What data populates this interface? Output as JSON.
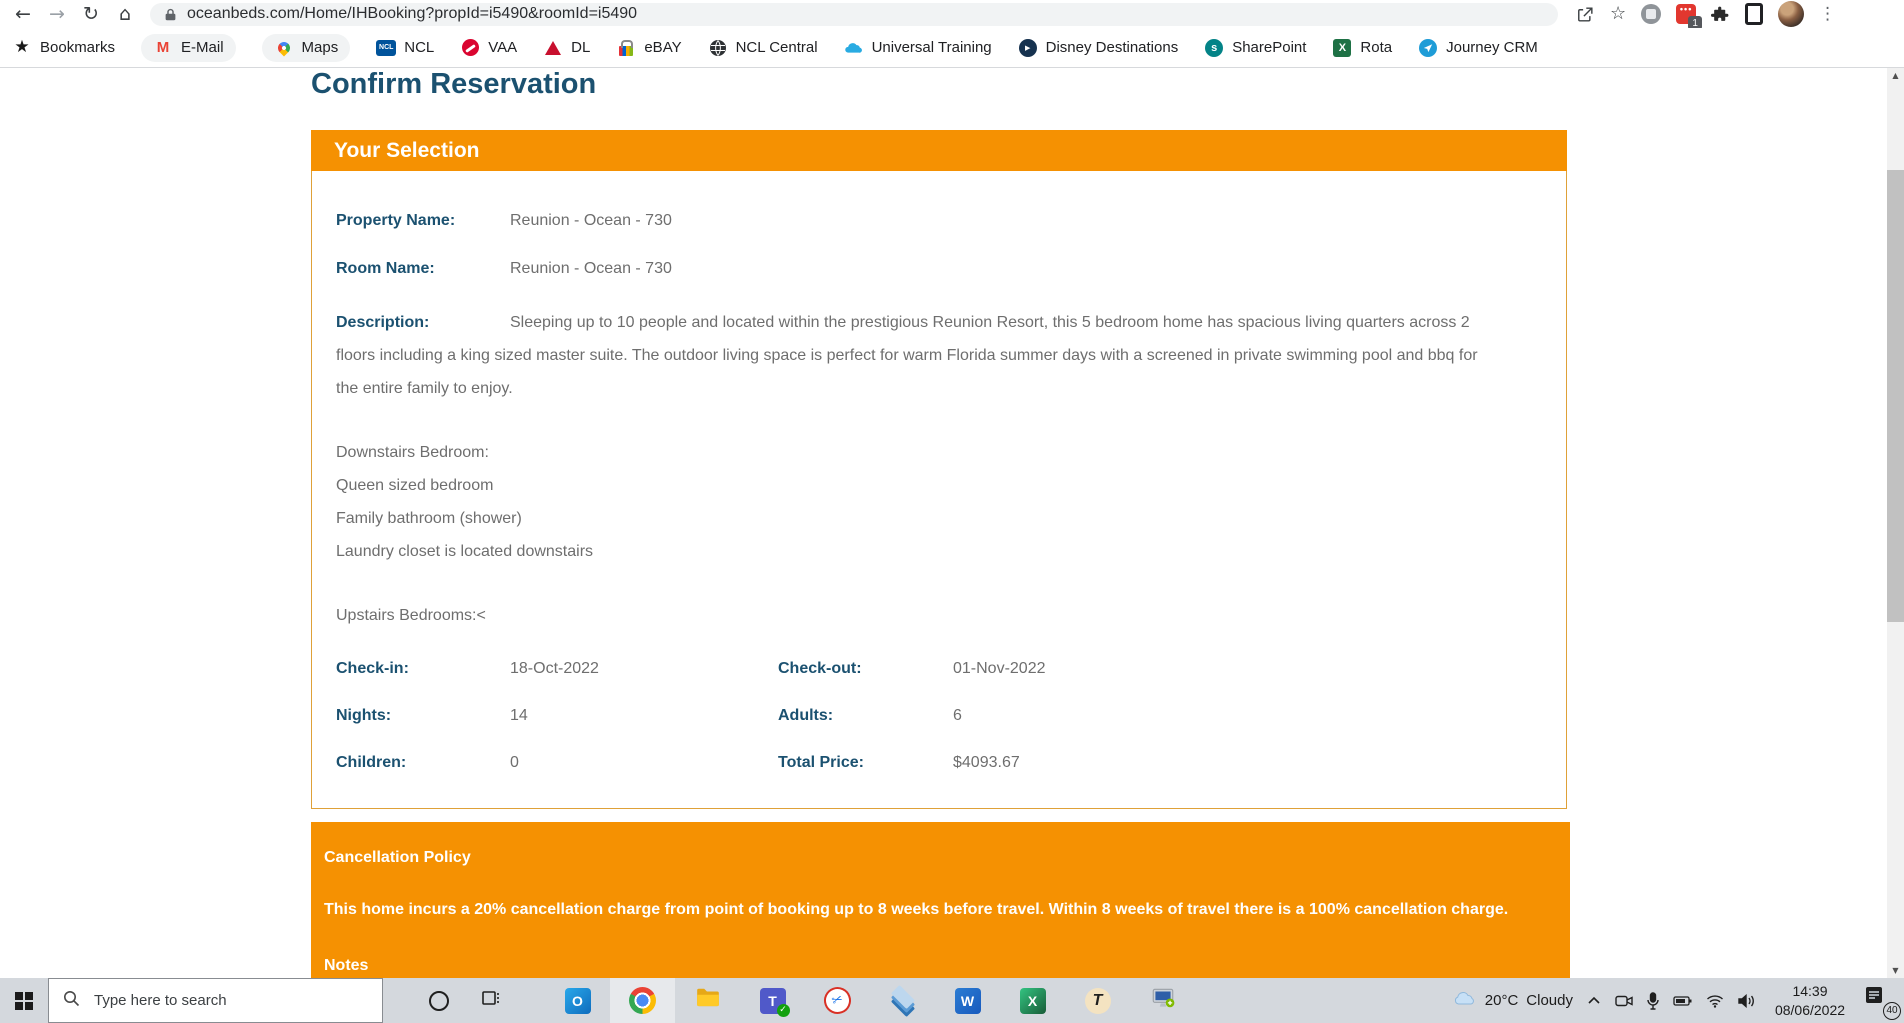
{
  "browser": {
    "url": "oceanbeds.com/Home/IHBooking?propId=i5490&roomId=i5490",
    "extension_badge": "1",
    "bookmarks": [
      {
        "label": "Bookmarks"
      },
      {
        "label": "E-Mail"
      },
      {
        "label": "Maps"
      },
      {
        "label": "NCL"
      },
      {
        "label": "VAA"
      },
      {
        "label": "DL"
      },
      {
        "label": "eBAY"
      },
      {
        "label": "NCL Central"
      },
      {
        "label": "Universal Training"
      },
      {
        "label": "Disney Destinations"
      },
      {
        "label": "SharePoint"
      },
      {
        "label": "Rota"
      },
      {
        "label": "Journey CRM"
      }
    ]
  },
  "page": {
    "heading": "Confirm Reservation",
    "selection": {
      "title": "Your Selection",
      "property_name": {
        "label": "Property Name:",
        "value": "Reunion - Ocean - 730"
      },
      "room_name": {
        "label": "Room Name:",
        "value": "Reunion - Ocean - 730"
      },
      "description": {
        "label": "Description:",
        "text": "Sleeping up to 10 people and located within the prestigious Reunion Resort, this 5 bedroom home has spacious living quarters across 2 floors including a king sized master suite. The outdoor living space is perfect for warm Florida summer days with a screened in private swimming pool and bbq for the entire family to enjoy."
      },
      "detail_lines": [
        "Downstairs Bedroom:",
        "Queen sized bedroom",
        "Family bathroom (shower)",
        "Laundry closet is located downstairs",
        "Upstairs Bedrooms:<"
      ],
      "grid": {
        "check_in": {
          "label": "Check-in:",
          "value": "18-Oct-2022"
        },
        "check_out": {
          "label": "Check-out:",
          "value": "01-Nov-2022"
        },
        "nights": {
          "label": "Nights:",
          "value": "14"
        },
        "adults": {
          "label": "Adults:",
          "value": "6"
        },
        "children": {
          "label": "Children:",
          "value": "0"
        },
        "total_price": {
          "label": "Total Price:",
          "value": "$4093.67"
        }
      }
    },
    "cancellation": {
      "title": "Cancellation Policy",
      "body": "This home incurs a 20% cancellation charge from point of booking up to 8 weeks before travel. Within 8 weeks of travel there is a 100% cancellation charge.",
      "notes_title": "Notes"
    }
  },
  "taskbar": {
    "search_placeholder": "Type here to search",
    "weather": {
      "temp": "20°C",
      "condition": "Cloudy"
    },
    "clock": {
      "time": "14:39",
      "date": "08/06/2022"
    },
    "notification_badge": "40"
  },
  "colors": {
    "accent_orange": "#F59102",
    "heading_navy": "#1B5170",
    "body_gray": "#6E6E6E"
  }
}
